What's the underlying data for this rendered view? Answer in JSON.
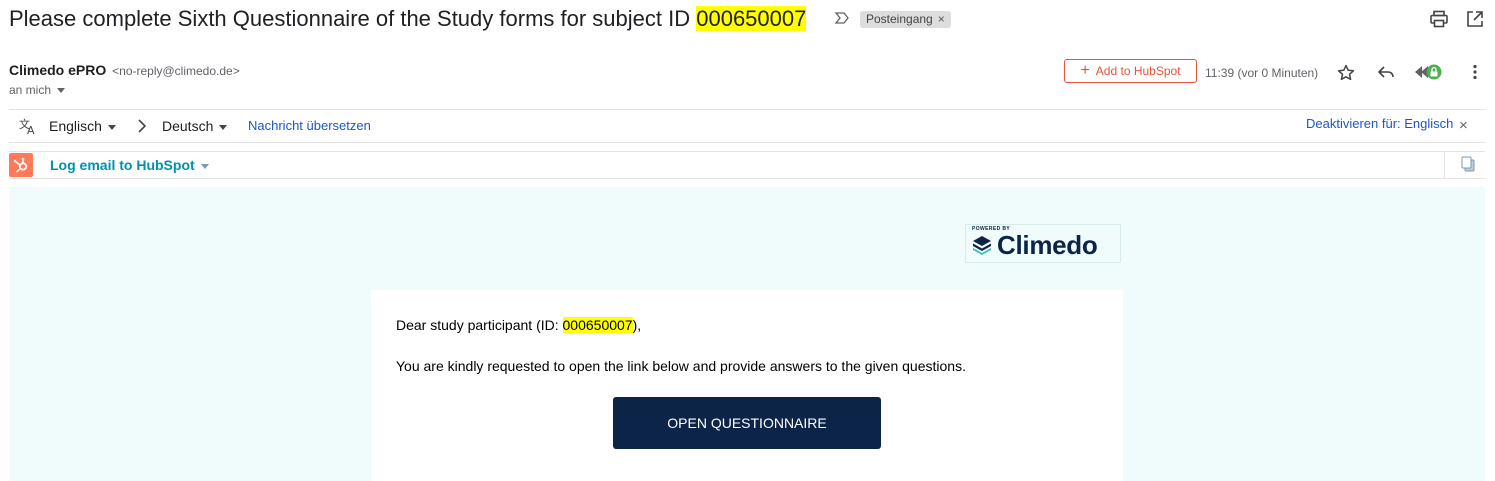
{
  "subject": {
    "text_prefix": "Please complete Sixth Questionnaire of the Study forms for subject ID ",
    "highlighted_id": "000650007",
    "label": "Posteingang",
    "label_close": "×"
  },
  "header_icons": {
    "importance": "importance-marker-icon",
    "print": "print-icon",
    "new_window": "open-in-new-window-icon"
  },
  "sender": {
    "name": "Climedo ePRO",
    "email": "<no-reply@climedo.de>",
    "recipient": "an mich"
  },
  "actions": {
    "hubspot_button": "Add to HubSpot",
    "time": "11:39 (vor 0 Minuten)",
    "icons": [
      "star-icon",
      "reply-icon",
      "extension-lock-icon",
      "more-vert-icon"
    ]
  },
  "translate_bar": {
    "from_language": "Englisch",
    "to_language": "Deutsch",
    "translate_link": "Nachricht übersetzen",
    "deactivate_link": "Deaktivieren für: Englisch",
    "close": "×"
  },
  "hubspot_bar": {
    "label": "Log email to HubSpot"
  },
  "email": {
    "brand_powered": "POWERED BY",
    "brand_name": "Climedo",
    "greeting_prefix": "Dear study participant (ID: ",
    "greeting_id": "000650007",
    "greeting_suffix": "),",
    "body": "You are kindly requested to open the link below and provide answers to the given questions.",
    "cta": "OPEN QUESTIONNAIRE"
  },
  "colors": {
    "highlight": "#ffff00",
    "hubspot_orange": "#ff7a59",
    "link_blue": "#1a57c8",
    "email_background": "#f0fbfb",
    "cta_navy": "#0b2447"
  }
}
